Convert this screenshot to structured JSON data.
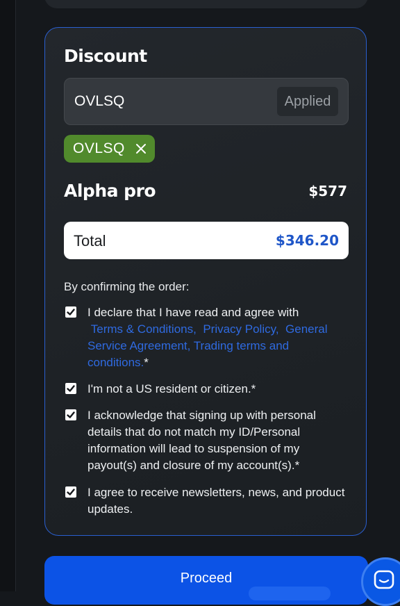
{
  "discount": {
    "title": "Discount",
    "code_value": "OVLSQ",
    "applied_label": "Applied",
    "chip_label": "OVLSQ"
  },
  "plan": {
    "name": "Alpha pro",
    "price": "$577"
  },
  "total": {
    "label": "Total",
    "value": "$346.20"
  },
  "confirm": {
    "intro": "By confirming the order:",
    "item1_text": "I declare that I have read and agree with",
    "item1_links": {
      "terms": "Terms & Conditions,",
      "privacy": "Privacy Policy,",
      "general": "General Service Agreement,",
      "trading": "Trading terms and conditions."
    },
    "required_mark": "*",
    "item2": "I'm not a US resident or citizen.*",
    "item3": "I acknowledge that signing up with personal details that do not match my ID/Personal information will lead to suspension of my payout(s) and closure of my account(s).*",
    "item4": "I agree to receive newsletters, news, and product updates."
  },
  "proceed": {
    "label": "Proceed"
  },
  "colors": {
    "accent": "#0c53e6",
    "link": "#2f6ae0",
    "chip": "#518a2c",
    "total_value": "#1f56c8"
  },
  "icons": {
    "chip_remove": "close-icon",
    "checkbox": "checkmark-icon",
    "chat": "chat-bubble-icon"
  }
}
